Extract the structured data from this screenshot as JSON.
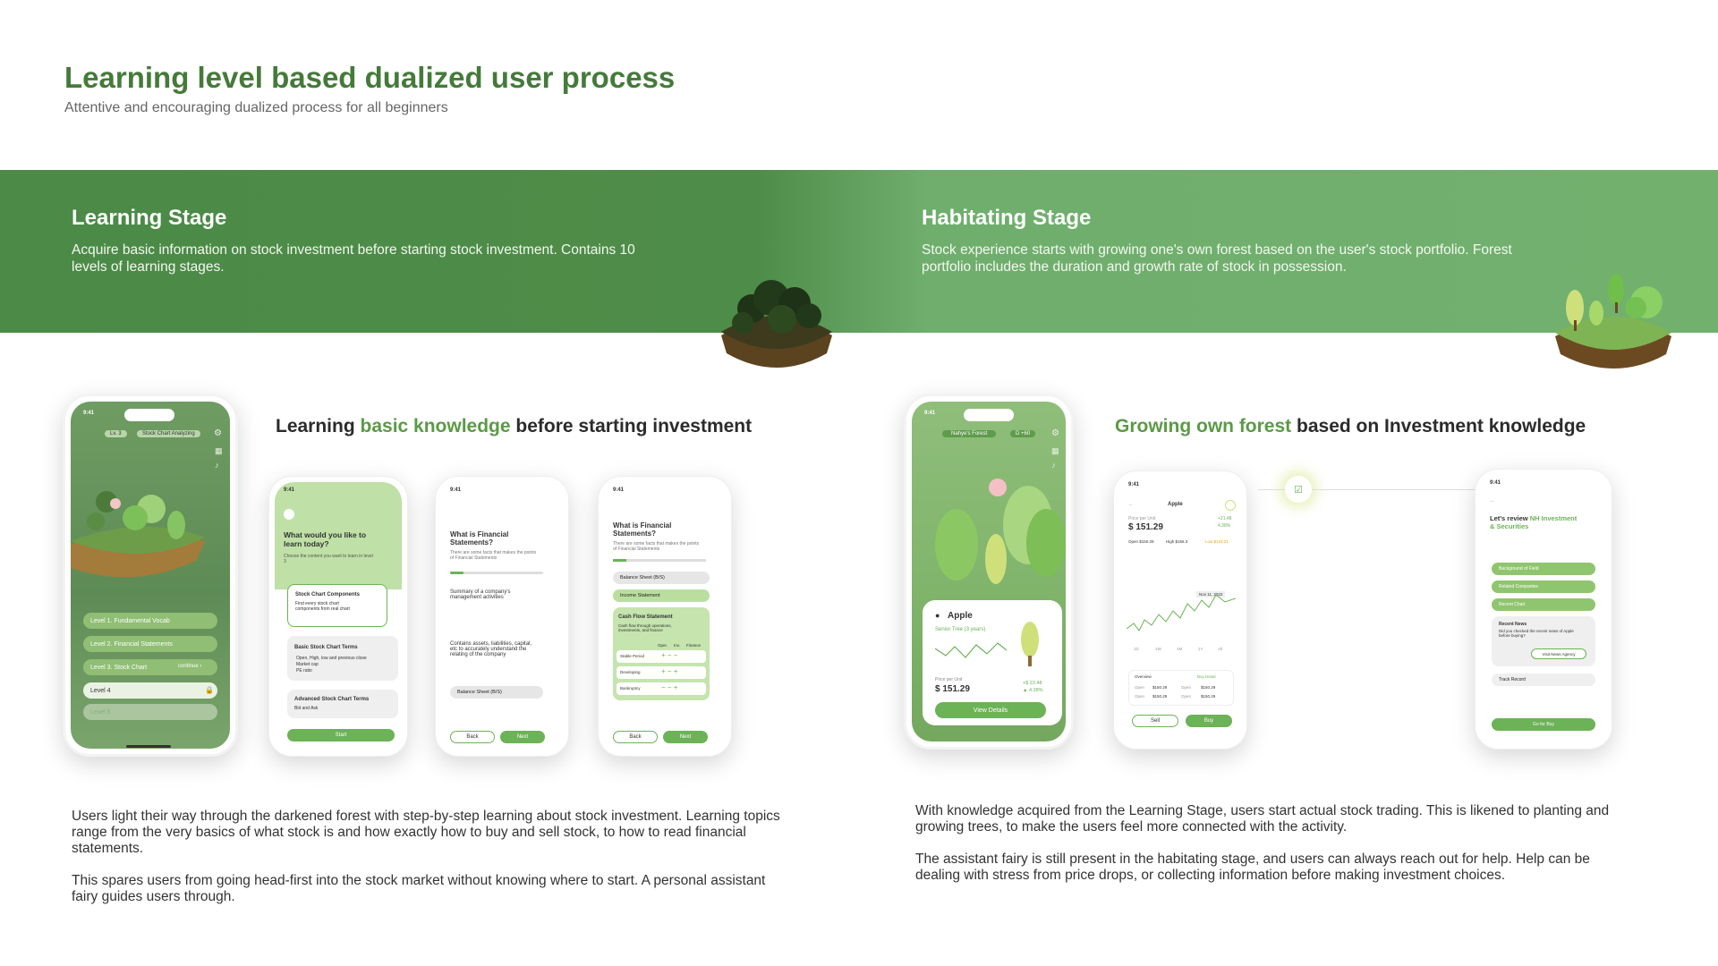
{
  "header": {
    "title": "Learning level based dualized user process",
    "subtitle": "Attentive and encouraging dualized process for all beginners"
  },
  "learning": {
    "stage_title": "Learning Stage",
    "stage_desc": "Acquire basic information on stock investment before starting stock investment. Contains 10 levels of learning stages.",
    "section_pre": "Learning ",
    "section_accent": "basic knowledge",
    "section_post": " before starting investment",
    "para1": "Users light their way through the darkened forest with step-by-step learning about stock investment. Learning topics range from the very basics of what stock is and how exactly how to buy and sell stock, to how to read financial statements.",
    "para2": "This spares users from going head-first into the stock market without knowing where to start. A personal assistant fairy guides users through.",
    "phone1": {
      "time": "9:41",
      "level_badge": "Lv. 3",
      "mode_badge": "Stock Chart Analyzing",
      "levels": [
        "Level 1. Fundamental Vocab",
        "Level 2. Financial Statements",
        "Level 3. Stock Chart",
        "Level 4",
        "Level 5"
      ],
      "continue": "continue ›"
    },
    "phone2": {
      "time": "9:41",
      "question": "What would you like to learn today?",
      "hint": "Choose the content you want to learn in level 3",
      "card1_title": "Stock Chart Components",
      "card1_text": "Find every stock chart components from real chart",
      "card2_title": "Basic Stock Chart Terms",
      "card2_items": [
        "Open, High, low and previous close",
        "Market cap",
        "PE ratio"
      ],
      "card3_title": "Advanced Stock Chart Terms",
      "card3_text": "Bid and Ask",
      "start": "Start"
    },
    "phone3": {
      "time": "9:41",
      "title": "What is Financial Statements?",
      "hint": "There are some facts that makes the points of Financial Statements",
      "q1": "Summary of a company's management activities",
      "q2": "Contains assets, liabilities, capital, etc to accurately understand the relating of the company",
      "opt": "Balance Sheet (B/S)",
      "back": "Back",
      "next": "Next"
    },
    "phone4": {
      "time": "9:41",
      "title": "What is Financial Statements?",
      "hint": "There are some facts that makes the points of Financial Statements",
      "opt1": "Balance Sheet (B/S)",
      "opt2": "Income Statement",
      "opt3": "Cash Flow Statement",
      "opt3_desc": "Cash flow through operations, investments, and finance",
      "cols": [
        "Oper.",
        "Inv.",
        "Finance"
      ],
      "rows": [
        "Stable Period",
        "Developing",
        "Bankruptcy"
      ],
      "back": "Back",
      "next": "Next"
    }
  },
  "habitating": {
    "stage_title": "Habitating Stage",
    "stage_desc": "Stock experience starts with growing one's own forest based on the user's stock portfolio. Forest portfolio includes the duration and growth rate of stock in possession.",
    "section_accent": "Growing own forest",
    "section_post": " based on Investment knowledge",
    "para1": "With knowledge acquired from the Learning Stage, users start actual stock trading. This is likened to planting and growing trees, to make the users feel more connected with the activity.",
    "para2": "The assistant fairy is still present in the habitating stage, and users can always reach out for help. Help can be dealing with stress from price drops, or collecting information before making investment choices.",
    "phone1": {
      "time": "9:41",
      "forest_badge": "Nahye's Forest",
      "points": "D +60",
      "stock": "Apple",
      "tree": "Senior Tree (3 years)",
      "price_label": "Price per Unit",
      "price": "$ 151.29",
      "change1": "+$ 23.48",
      "change2": "▲ 4.38%",
      "cta": "View Details"
    },
    "phone2": {
      "time": "9:41",
      "stock": "Apple",
      "price_label": "Price per Unit",
      "price": "$ 151.29",
      "change1": "+21.48",
      "change2": "4.38%",
      "stats": [
        "Open $150.29",
        "High $166.3",
        "Low $123.21"
      ],
      "date": "Nov 11, 2022",
      "ranges": [
        "1D",
        "1W",
        "1M",
        "1Y",
        "All"
      ],
      "overview": "Overview",
      "buy_detail": "Buy Detail",
      "row_label": "Open",
      "row_value": "$150.29",
      "sell": "Sell",
      "buy": "Buy"
    },
    "phone3": {
      "time": "9:41",
      "title_pre": "Let's review ",
      "title_accent": "NH Investment & Securities",
      "items": [
        "Background of Field",
        "Related Companies",
        "Recent Chart"
      ],
      "news_title": "Recent News",
      "news_text": "Did you checked the recent news of Apple before buying?",
      "news_btn": "Visit News Agency",
      "track": "Track Record",
      "cta": "Go for Buy"
    }
  },
  "colors": {
    "brand_green": "#457a3a",
    "accent": "#6cb257",
    "band_dark": "#4c8a47",
    "band_light": "#72b06e"
  }
}
